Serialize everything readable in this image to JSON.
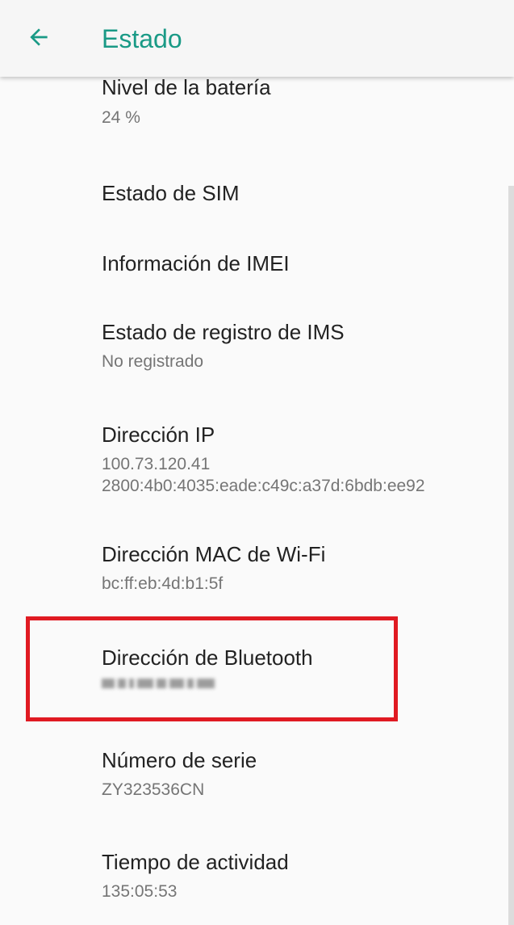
{
  "appbar": {
    "back_icon": "arrow-left-icon",
    "title": "Estado",
    "accent_color": "#1a9a86"
  },
  "items": [
    {
      "title": "Nivel de la batería",
      "summary": "24 %"
    },
    {
      "title": "Estado de SIM",
      "summary": ""
    },
    {
      "title": "Información de IMEI",
      "summary": ""
    },
    {
      "title": "Estado de registro de IMS",
      "summary": "No registrado"
    },
    {
      "title": "Dirección IP",
      "summary": "100.73.120.41\n2800:4b0:4035:eade:c49c:a37d:6bdb:ee92"
    },
    {
      "title": "Dirección MAC de Wi-Fi",
      "summary": "bc:ff:eb:4d:b1:5f"
    },
    {
      "title": "Dirección de Bluetooth",
      "summary": ""
    },
    {
      "title": "Número de serie",
      "summary": "ZY323536CN"
    },
    {
      "title": "Tiempo de actividad",
      "summary": "135:05:53"
    }
  ],
  "highlight_color": "#e01a22"
}
